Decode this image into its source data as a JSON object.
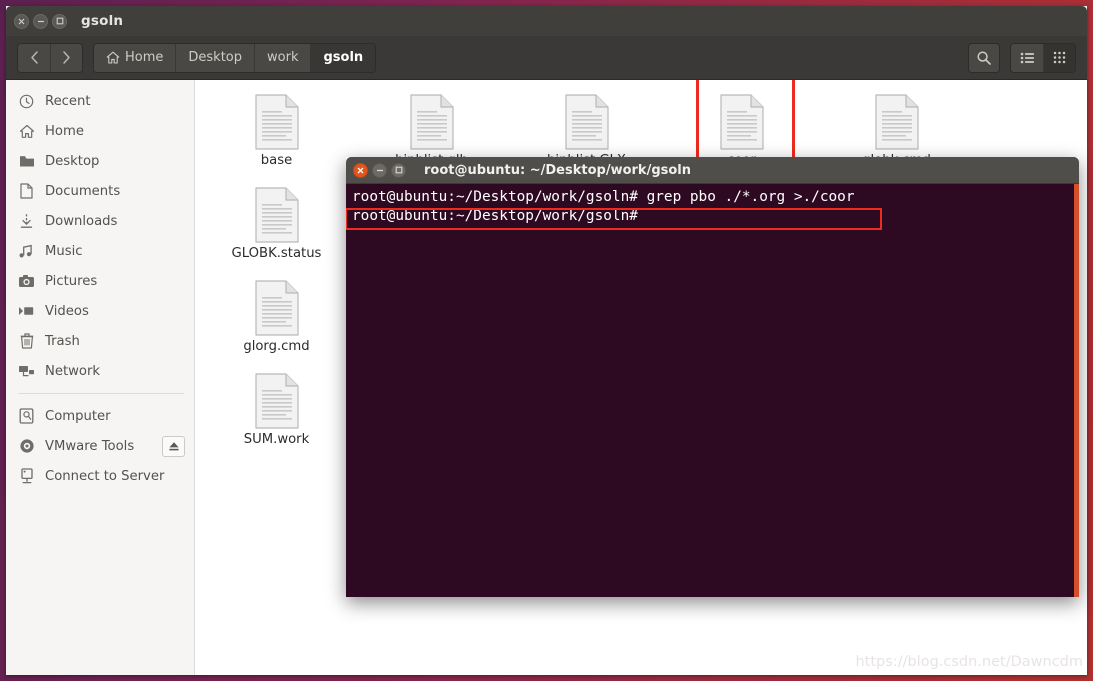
{
  "window": {
    "title": "gsoln",
    "controls": [
      {
        "name": "close",
        "glyph": "×"
      },
      {
        "name": "minimize",
        "glyph": "−"
      },
      {
        "name": "maximize",
        "glyph": "□"
      }
    ]
  },
  "toolbar": {
    "back_label": "‹",
    "forward_label": "›",
    "breadcrumbs": [
      {
        "label": "Home",
        "icon": "home-icon",
        "active": false
      },
      {
        "label": "Desktop",
        "icon": "",
        "active": false
      },
      {
        "label": "work",
        "icon": "",
        "active": false
      },
      {
        "label": "gsoln",
        "icon": "",
        "active": true
      }
    ],
    "search_icon": "search-icon",
    "view_list_icon": "list-view-icon",
    "view_grid_icon": "grid-view-icon",
    "active_view": "grid"
  },
  "sidebar": {
    "items": [
      {
        "label": "Recent",
        "icon": "clock-icon"
      },
      {
        "label": "Home",
        "icon": "home-icon"
      },
      {
        "label": "Desktop",
        "icon": "folder-icon"
      },
      {
        "label": "Documents",
        "icon": "document-icon"
      },
      {
        "label": "Downloads",
        "icon": "download-icon"
      },
      {
        "label": "Music",
        "icon": "music-icon"
      },
      {
        "label": "Pictures",
        "icon": "camera-icon"
      },
      {
        "label": "Videos",
        "icon": "video-icon"
      },
      {
        "label": "Trash",
        "icon": "trash-icon"
      },
      {
        "label": "Network",
        "icon": "network-icon"
      }
    ],
    "devices": [
      {
        "label": "Computer",
        "icon": "computer-icon",
        "eject": false
      },
      {
        "label": "VMware Tools",
        "icon": "disc-icon",
        "eject": true
      },
      {
        "label": "Connect to Server",
        "icon": "server-icon",
        "eject": false
      }
    ]
  },
  "files": [
    {
      "name": "base",
      "icon": "document-icon",
      "selected": false
    },
    {
      "name": "binhlist.glb",
      "icon": "document-icon",
      "selected": false
    },
    {
      "name": "binhlist.GLX",
      "icon": "document-icon",
      "selected": false
    },
    {
      "name": "coor",
      "icon": "document-icon",
      "selected": true
    },
    {
      "name": "globk.cmd",
      "icon": "document-icon",
      "selected": false
    },
    {
      "name": "GLOBK.status",
      "icon": "document-icon",
      "selected": false
    },
    {
      "name": "glorg.cmd",
      "icon": "document-icon",
      "selected": false
    },
    {
      "name": "SUM.work",
      "icon": "document-icon",
      "selected": false
    }
  ],
  "terminal": {
    "title": "root@ubuntu: ~/Desktop/work/gsoln",
    "controls": [
      {
        "name": "close",
        "glyph": "×"
      },
      {
        "name": "minimize",
        "glyph": "−"
      },
      {
        "name": "maximize",
        "glyph": "□"
      }
    ],
    "lines": [
      "root@ubuntu:~/Desktop/work/gsoln# grep pbo ./*.org >./coor",
      "root@ubuntu:~/Desktop/work/gsoln#"
    ]
  },
  "annotations": {
    "coor_box": "highlight-coor-file",
    "command_box": "highlight-grep-command",
    "accent_color": "#ef2a1e"
  },
  "watermark": {
    "text": "https://blog.csdn.net/Dawncdm"
  },
  "colors": {
    "titlebar": "#413f3c",
    "toolbar": "#3b3937",
    "sidebar_bg": "#f6f5f4",
    "terminal_bg": "#2e0a22",
    "annotation_red": "#ef2a1e",
    "close_orange": "#e0561d"
  }
}
